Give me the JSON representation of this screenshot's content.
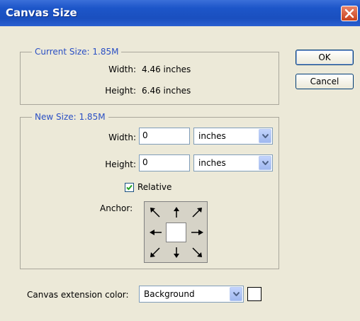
{
  "window": {
    "title": "Canvas Size"
  },
  "current_size": {
    "legend": "Current Size: 1.85M",
    "width_label": "Width:",
    "width_value": "4.46 inches",
    "height_label": "Height:",
    "height_value": "6.46 inches"
  },
  "new_size": {
    "legend": "New Size: 1.85M",
    "width_label": "Width:",
    "width_value": "0",
    "width_unit": "inches",
    "height_label": "Height:",
    "height_value": "0",
    "height_unit": "inches",
    "relative_label": "Relative",
    "relative_checked": true,
    "anchor_label": "Anchor:"
  },
  "buttons": {
    "ok": "OK",
    "cancel": "Cancel"
  },
  "extension": {
    "label": "Canvas extension color:",
    "value": "Background",
    "swatch_color": "#ffffff"
  },
  "colors": {
    "accent": "#2a4fc4",
    "titlebar": "#1d56c9"
  }
}
